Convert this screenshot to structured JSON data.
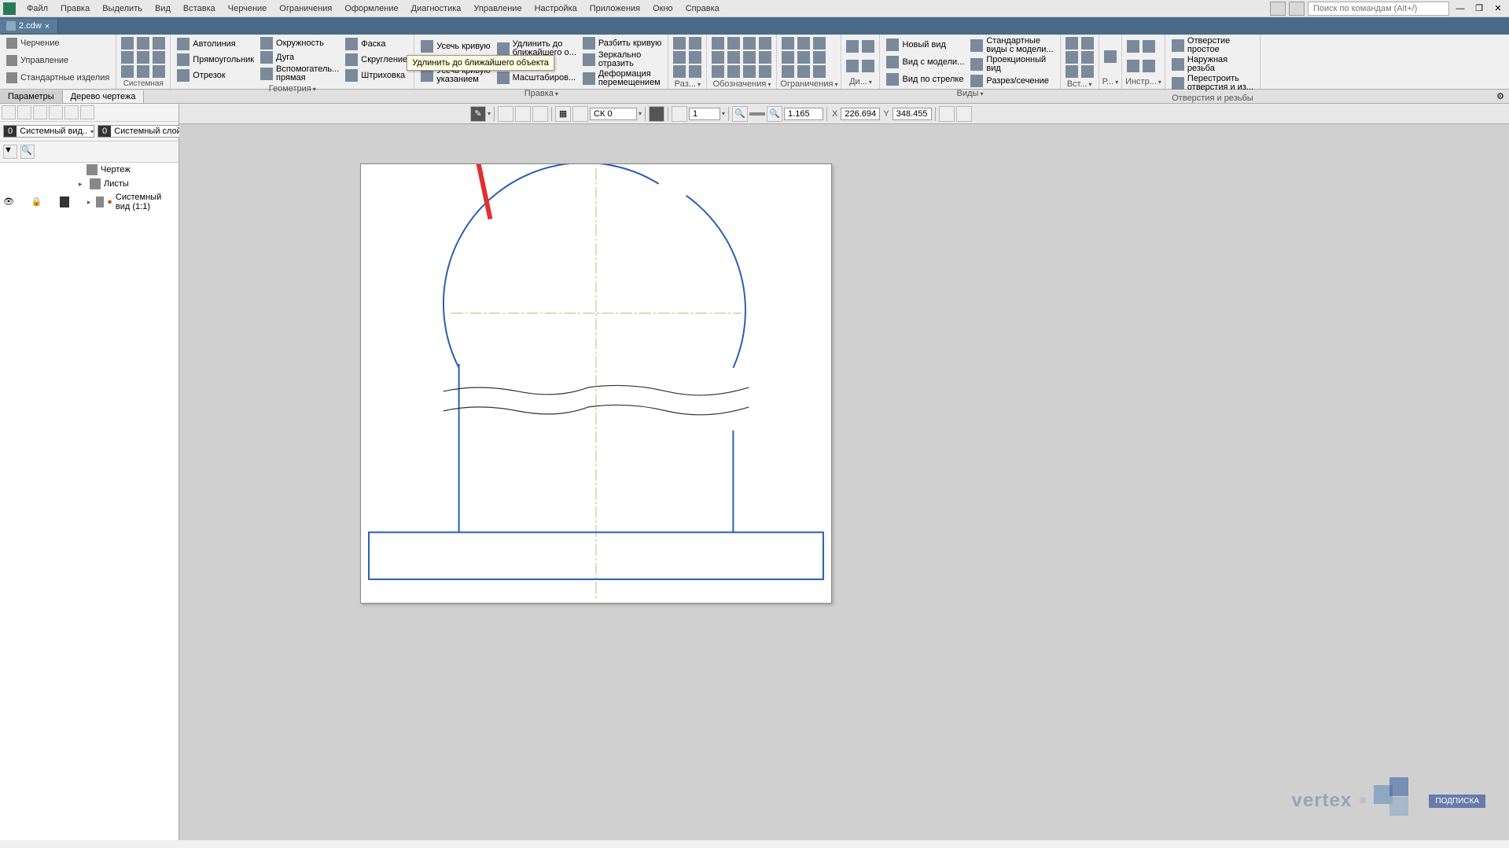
{
  "menu": {
    "file": "Файл",
    "edit": "Правка",
    "select": "Выделить",
    "view": "Вид",
    "insert": "Вставка",
    "drawing": "Черчение",
    "constraints": "Ограничения",
    "design": "Оформление",
    "diagnostics": "Диагностика",
    "manage": "Управление",
    "settings": "Настройка",
    "applications": "Приложения",
    "window": "Окно",
    "help": "Справка"
  },
  "search_placeholder": "Поиск по командам (Alt+/)",
  "tab": {
    "name": "2.cdw"
  },
  "ribbon_modes": {
    "drawing": "Черчение",
    "manage": "Управление",
    "std_products": "Стандартные изделия"
  },
  "groups": {
    "system": "Системная",
    "geometry": "Геометрия",
    "editing": "Правка",
    "dimensions": "Раз...",
    "annotations": "Обозначения",
    "constraints": "Ограничения",
    "d": "Ди...",
    "views": "Виды",
    "insert": "Вст...",
    "r": "Р...",
    "tools": "Инстр...",
    "holes": "Отверстия и резьбы"
  },
  "geometry": {
    "autoline": "Автолиния",
    "rectangle": "Прямоугольник",
    "segment": "Отрезок",
    "circle": "Окружность",
    "arc": "Дуга",
    "aux_line": "Вспомогатель...\nпрямая",
    "chamfer": "Фаска",
    "fillet": "Скругление",
    "hatch": "Штриховка"
  },
  "editing": {
    "trim_curve": "Усечь кривую",
    "trim_ptr": "Усечь кривую\nуказанием",
    "extend_to": "Удлинить до\nближайшего о...",
    "scale": "Масштабиров...",
    "split_curve": "Разбить кривую",
    "mirror": "Зеркально\nотразить",
    "move_deform": "Деформация\nперемещением"
  },
  "tooltip": "Удлинить до ближайшего объекта",
  "views": {
    "new_view": "Новый вид",
    "model_view": "Вид с модели...",
    "arrow_view": "Вид по стрелке",
    "std_model_views": "Стандартные\nвиды с модели...",
    "projection_view": "Проекционный\nвид",
    "section_view": "Разрез/сечение"
  },
  "holes": {
    "simple_hole": "Отверстие\nпростое",
    "external_thread": "Наружная\nрезьба",
    "rebuild": "Перестроить\nотверстия и из..."
  },
  "params": {
    "tab_params": "Параметры",
    "tab_tree": "Дерево чертежа"
  },
  "layer_view": {
    "num": "0",
    "name": "Системный вид.."
  },
  "layer_layer": {
    "num": "0",
    "name": "Системный слой"
  },
  "tree": {
    "root": "Чертеж",
    "sheets": "Листы",
    "sys_view": "Системный вид (1:1)"
  },
  "canvas_toolbar": {
    "coord_sys": "СК 0",
    "scale": "1",
    "zoom": "1.165",
    "x": "226.694",
    "y": "348.455",
    "x_label": "X",
    "y_label": "Y"
  },
  "watermark": {
    "text": "vertex",
    "badge": "ПОДПИСКА"
  }
}
